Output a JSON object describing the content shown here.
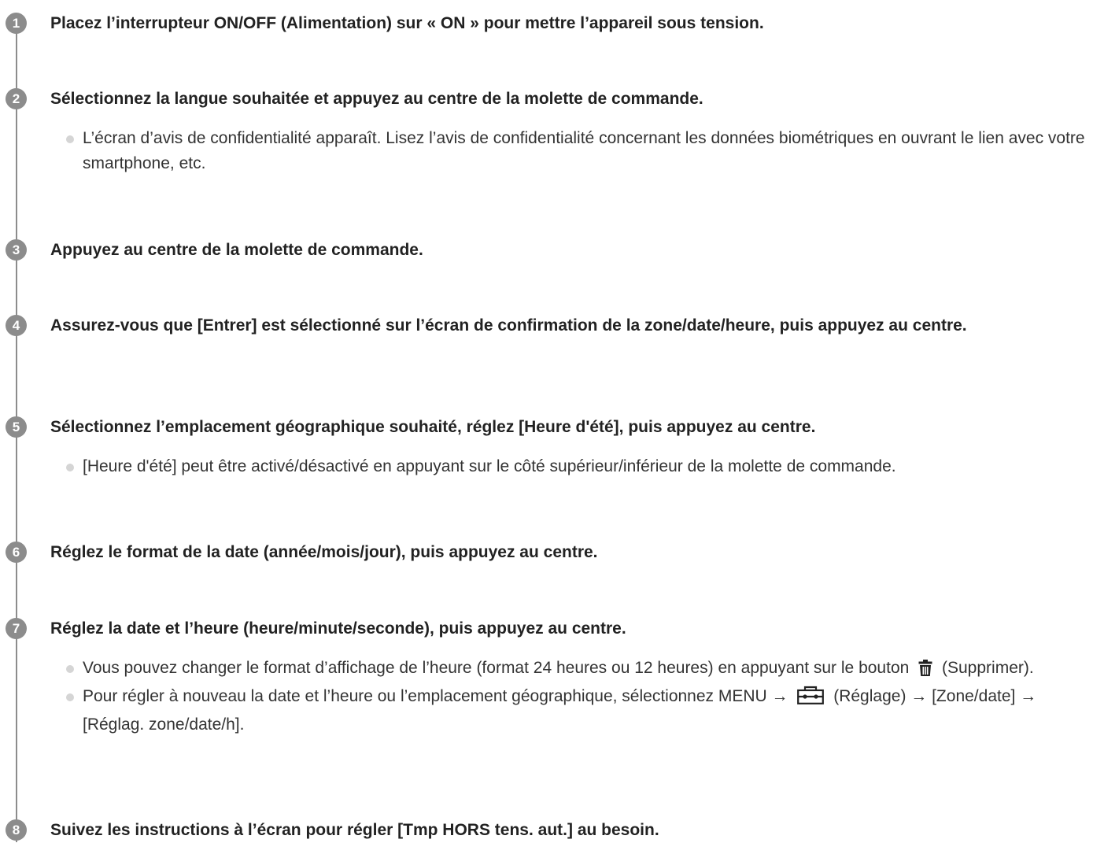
{
  "steps": [
    {
      "number": "1",
      "title": "Placez l’interrupteur ON/OFF (Alimentation) sur « ON » pour mettre l’appareil sous tension.",
      "bullets": []
    },
    {
      "number": "2",
      "title": "Sélectionnez la langue souhaitée et appuyez au centre de la molette de commande.",
      "bullets": [
        "L’écran d’avis de confidentialité apparaît. Lisez l’avis de confidentialité concernant les données biométriques en ouvrant le lien avec votre smartphone, etc."
      ]
    },
    {
      "number": "3",
      "title": "Appuyez au centre de la molette de commande.",
      "bullets": []
    },
    {
      "number": "4",
      "title": "Assurez-vous que [Entrer] est sélectionné sur l’écran de confirmation de la zone/date/heure, puis appuyez au centre.",
      "bullets": []
    },
    {
      "number": "5",
      "title": "Sélectionnez l’emplacement géographique souhaité, réglez [Heure d'été], puis appuyez au centre.",
      "bullets": [
        "[Heure d'été] peut être activé/désactivé en appuyant sur le côté supérieur/inférieur de la molette de commande."
      ]
    },
    {
      "number": "6",
      "title": "Réglez le format de la date (année/mois/jour), puis appuyez au centre.",
      "bullets": []
    },
    {
      "number": "7",
      "title": "Réglez la date et l’heure (heure/minute/seconde), puis appuyez au centre.",
      "bullets": [
        {
          "before": "Vous pouvez changer le format d’affichage de l’heure (format 24 heures ou 12 heures) en appuyant sur le bouton",
          "icon": "trash-icon",
          "after": "(Supprimer)."
        },
        {
          "before": "Pour régler à nouveau la date et l’heure ou l’emplacement géographique, sélectionnez MENU →",
          "icon": "toolbox-icon",
          "after": "(Réglage) → [Zone/date] → [Réglag. zone/date/h]."
        }
      ]
    },
    {
      "number": "8",
      "title": "Suivez les instructions à l’écran pour régler [Tmp HORS tens. aut.] au besoin.",
      "bullets": []
    }
  ]
}
